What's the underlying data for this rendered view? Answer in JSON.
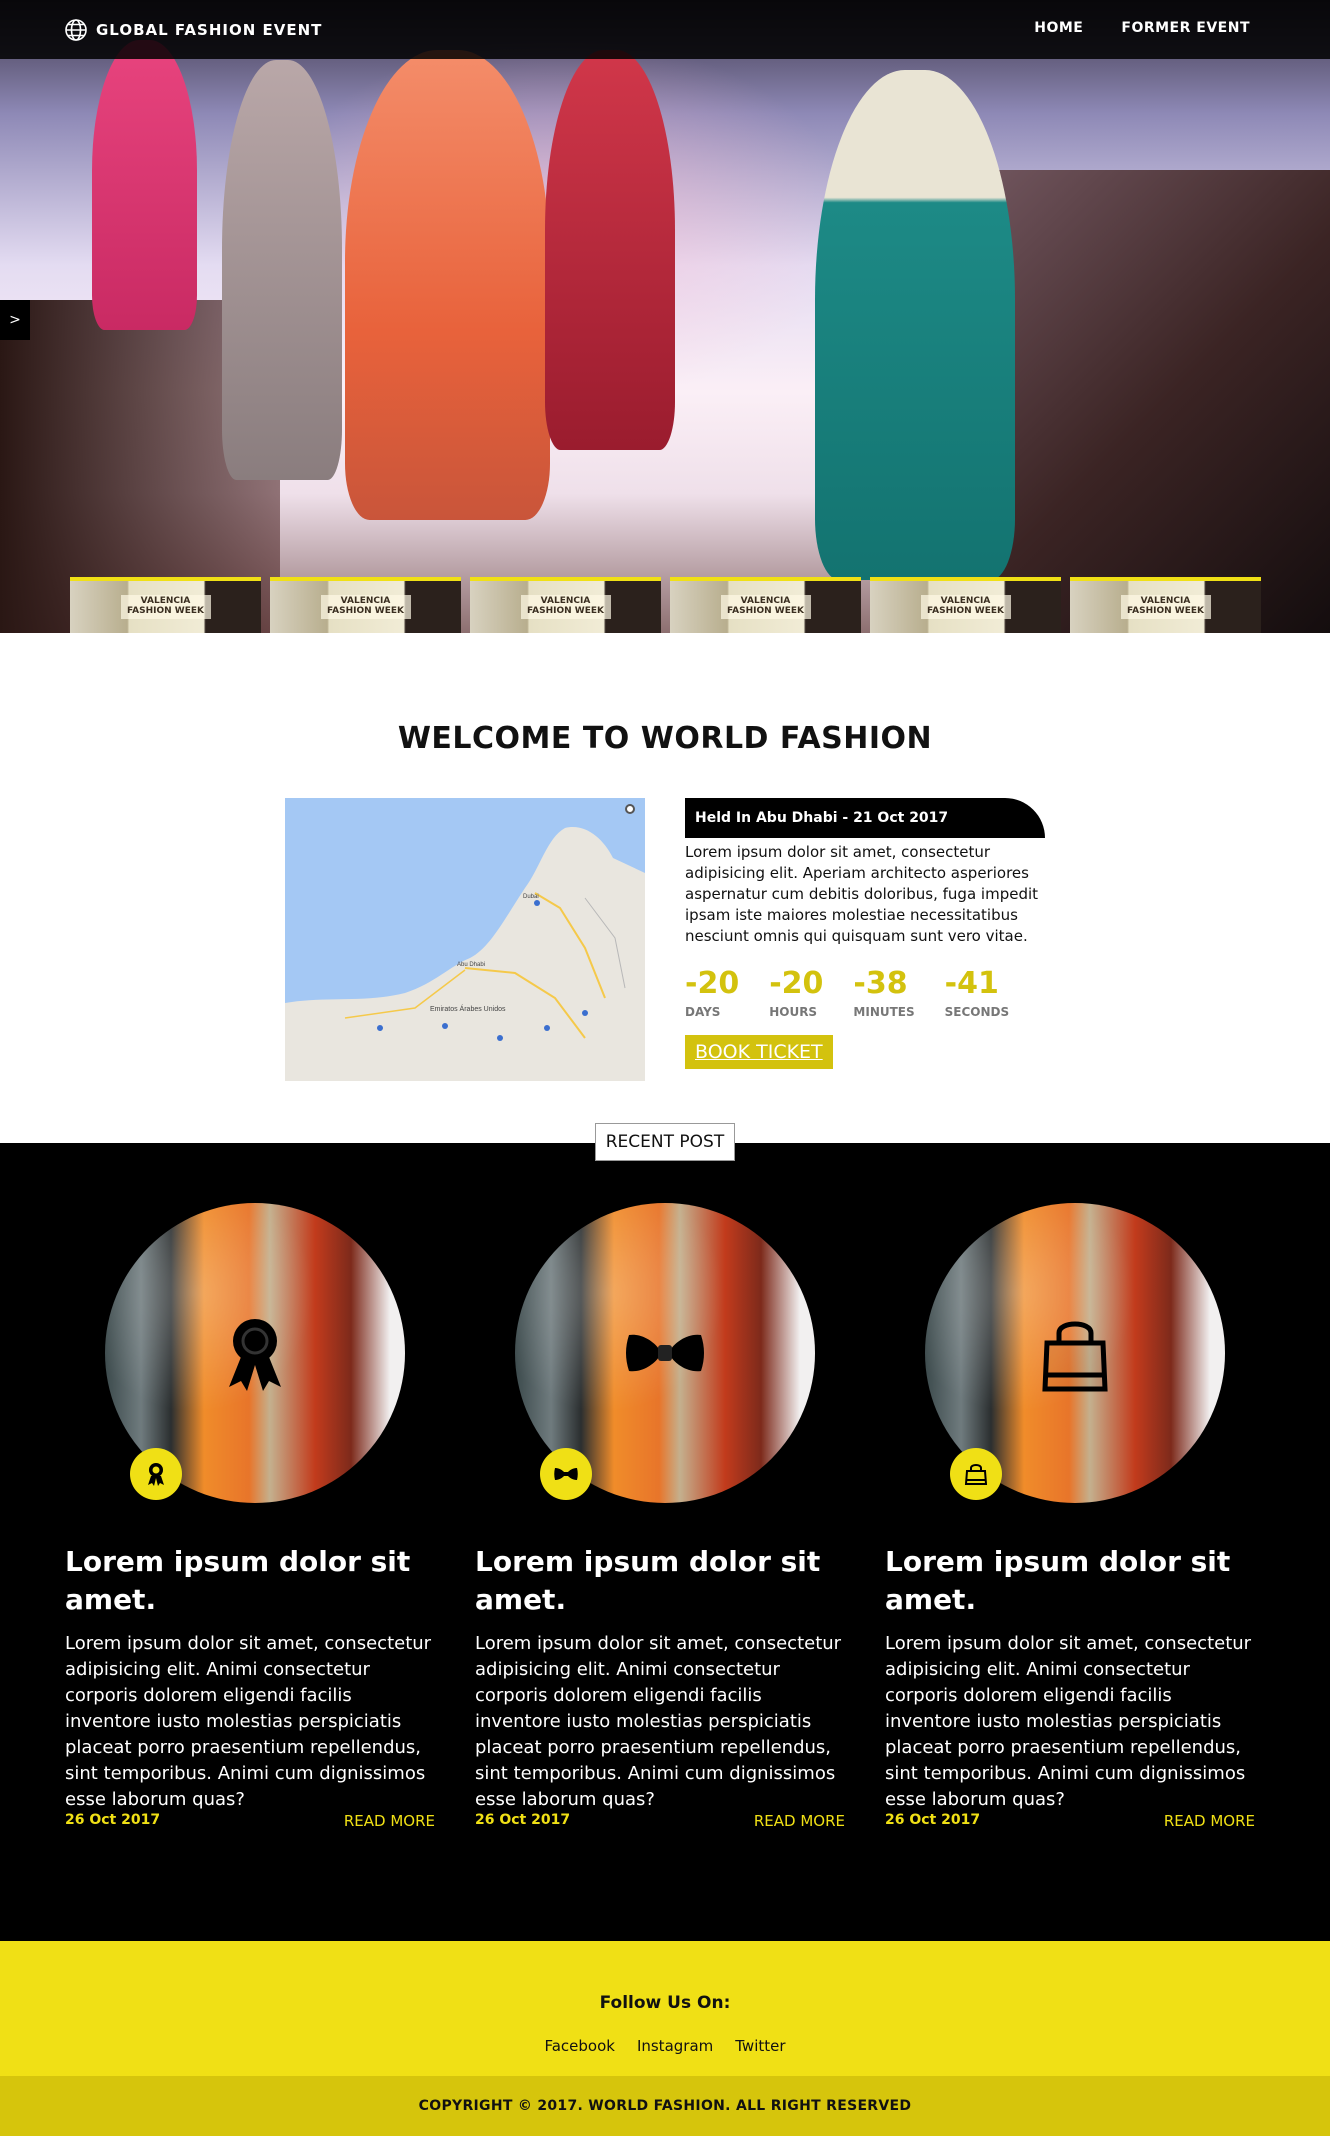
{
  "nav": {
    "brand": "GLOBAL FASHION EVENT",
    "links": [
      "HOME",
      "FORMER EVENT"
    ]
  },
  "hero": {
    "arrow": ">",
    "thumb_label": "VALENCIA FASHION WEEK"
  },
  "welcome": {
    "title": "WELCOME TO WORLD FASHION",
    "map_labels": [
      "Emiratos Árabes Unidos",
      "Abu Dhabi",
      "Dubai"
    ],
    "held": "Held In Abu Dhabi - 21 Oct 2017",
    "description": "Lorem ipsum dolor sit amet, consectetur adipisicing elit. Aperiam architecto asperiores aspernatur cum debitis doloribus, fuga impedit ipsam iste maiores molestiae necessitatibus nesciunt omnis qui quisquam sunt vero vitae.",
    "countdown": [
      {
        "value": "-20",
        "label": "DAYS"
      },
      {
        "value": "-20",
        "label": "HOURS"
      },
      {
        "value": "-38",
        "label": "MINUTES"
      },
      {
        "value": "-41",
        "label": "SECONDS"
      }
    ],
    "book_label": "BOOK TICKET"
  },
  "recent_tab": "RECENT POST",
  "posts": [
    {
      "icon": "ribbon-award-icon",
      "title": "Lorem ipsum dolor sit amet.",
      "body": "Lorem ipsum dolor sit amet, consectetur adipisicing elit. Animi consectetur corporis dolorem eligendi facilis inventore iusto molestias perspiciatis placeat porro praesentium repellendus, sint temporibus. Animi cum dignissimos esse laborum quas?",
      "date": "26 Oct 2017",
      "read_more": "READ MORE"
    },
    {
      "icon": "bow-tie-icon",
      "title": "Lorem ipsum dolor sit amet.",
      "body": "Lorem ipsum dolor sit amet, consectetur adipisicing elit. Animi consectetur corporis dolorem eligendi facilis inventore iusto molestias perspiciatis placeat porro praesentium repellendus, sint temporibus. Animi cum dignissimos esse laborum quas?",
      "date": "26 Oct 2017",
      "read_more": "READ MORE"
    },
    {
      "icon": "shopping-bag-icon",
      "title": "Lorem ipsum dolor sit amet.",
      "body": "Lorem ipsum dolor sit amet, consectetur adipisicing elit. Animi consectetur corporis dolorem eligendi facilis inventore iusto molestias perspiciatis placeat porro praesentium repellendus, sint temporibus. Animi cum dignissimos esse laborum quas?",
      "date": "26 Oct 2017",
      "read_more": "READ MORE"
    }
  ],
  "footer": {
    "follow": "Follow Us On:",
    "socials": [
      "Facebook",
      "Instagram",
      "Twitter"
    ],
    "copyright": "COPYRIGHT © 2017. WORLD FASHION. ALL RIGHT RESERVED"
  },
  "colors": {
    "accent_yellow": "#f0e015",
    "accent_dark_yellow": "#d3c20e",
    "black": "#000000"
  }
}
